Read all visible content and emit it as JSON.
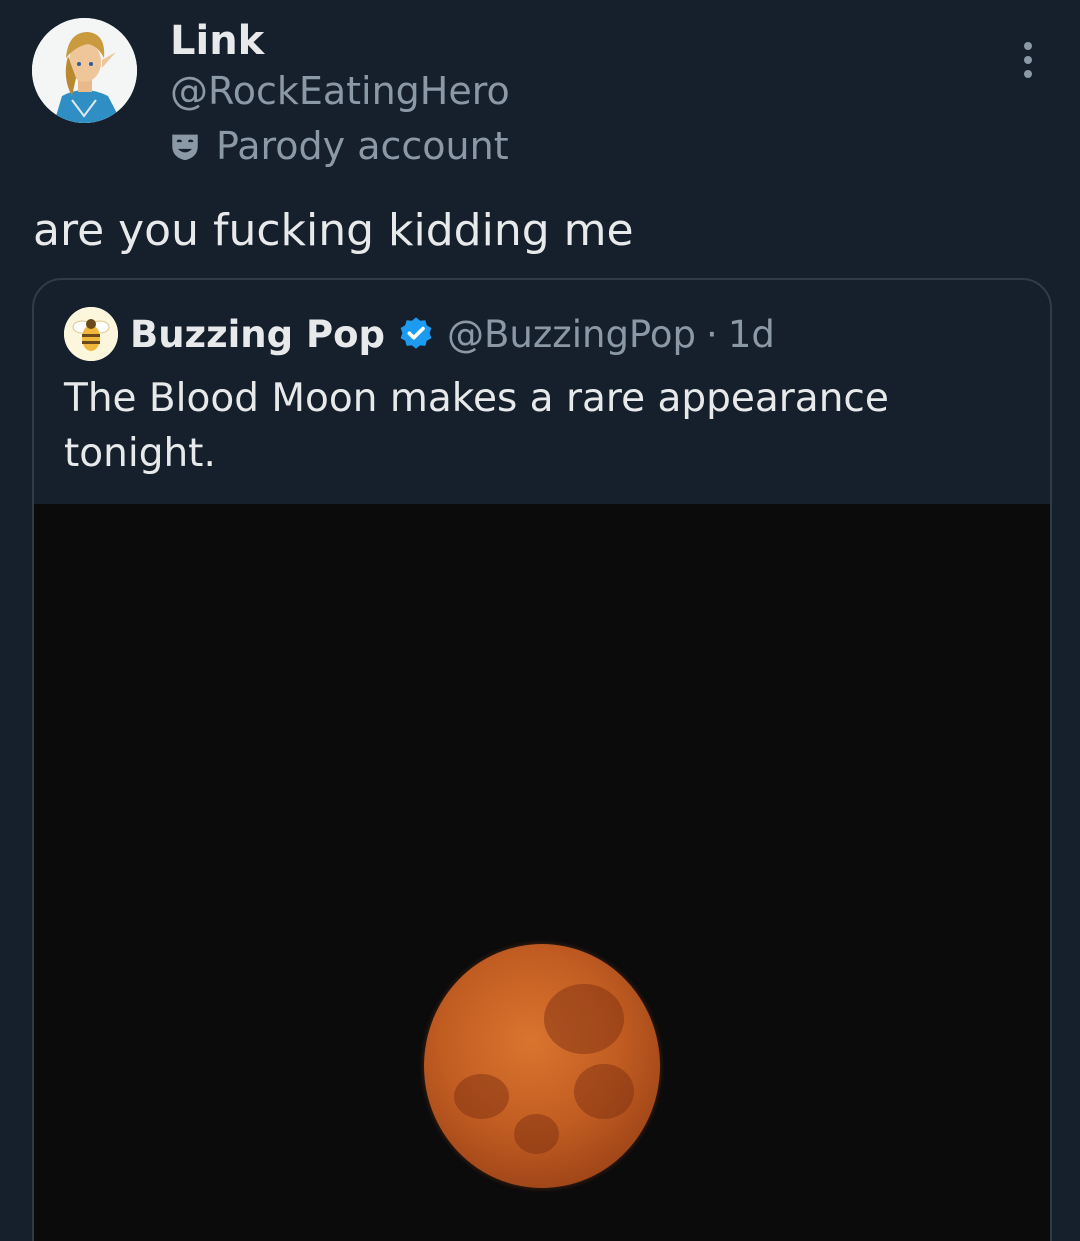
{
  "author": {
    "display_name": "Link",
    "handle": "@RockEatingHero",
    "parody_label": "Parody account",
    "avatar_icon": "character-portrait-avatar"
  },
  "tweet": {
    "text": "are you fucking kidding me"
  },
  "quote": {
    "display_name": "Buzzing Pop",
    "handle": "@BuzzingPop",
    "separator": "·",
    "time": "1d",
    "text": "The Blood Moon makes a rare appearance tonight.",
    "avatar_icon": "bee-icon",
    "verified_icon": "verified-badge-icon",
    "media": {
      "subject": "red moon in night sky"
    }
  },
  "colors": {
    "background": "#16202c",
    "primary_text": "#e7e9ea",
    "secondary_text": "#8b98a5",
    "verified_blue": "#1d9bf0",
    "card_border": "#2f3b47",
    "moon": "#c25d22"
  }
}
